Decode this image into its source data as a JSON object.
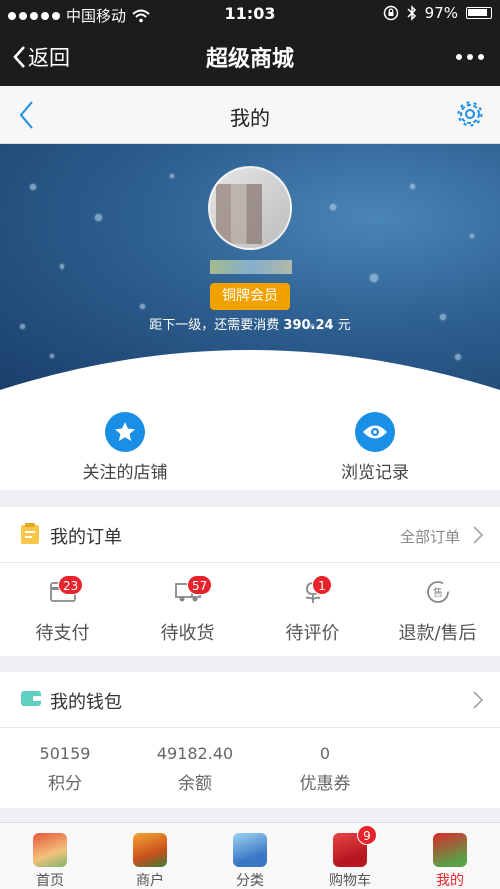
{
  "status_bar": {
    "carrier": "中国移动",
    "time": "11:03",
    "battery": "97%"
  },
  "wechat_nav": {
    "back_label": "返回",
    "title": "超级商城"
  },
  "page": {
    "title": "我的"
  },
  "profile": {
    "member_level": "铜牌会员",
    "upgrade_prefix": "距下一级，还需要消费",
    "upgrade_amount": "390.24",
    "upgrade_unit": "元"
  },
  "shortcuts": [
    {
      "label": "关注的店铺",
      "icon": "star-icon"
    },
    {
      "label": "浏览记录",
      "icon": "eye-icon"
    }
  ],
  "orders": {
    "title": "我的订单",
    "all_label": "全部订单",
    "items": [
      {
        "label": "待支付",
        "badge": "23",
        "icon": "wallet-card-icon"
      },
      {
        "label": "待收货",
        "badge": "57",
        "icon": "truck-icon"
      },
      {
        "label": "待评价",
        "badge": "1",
        "icon": "flower-icon"
      },
      {
        "label": "退款/售后",
        "badge": "",
        "icon": "refund-icon"
      }
    ]
  },
  "wallet": {
    "title": "我的钱包",
    "items": [
      {
        "value": "50159",
        "label": "积分"
      },
      {
        "value": "49182.40",
        "label": "余额"
      },
      {
        "value": "0",
        "label": "优惠券"
      }
    ]
  },
  "tabbar": [
    {
      "label": "首页",
      "badge": ""
    },
    {
      "label": "商户",
      "badge": ""
    },
    {
      "label": "分类",
      "badge": ""
    },
    {
      "label": "购物车",
      "badge": "9"
    },
    {
      "label": "我的",
      "badge": ""
    }
  ],
  "colors": {
    "accent_blue": "#1a8fe6",
    "badge_red": "#e8232b",
    "member_gold": "#f2a200",
    "active_tab": "#e8232b"
  }
}
